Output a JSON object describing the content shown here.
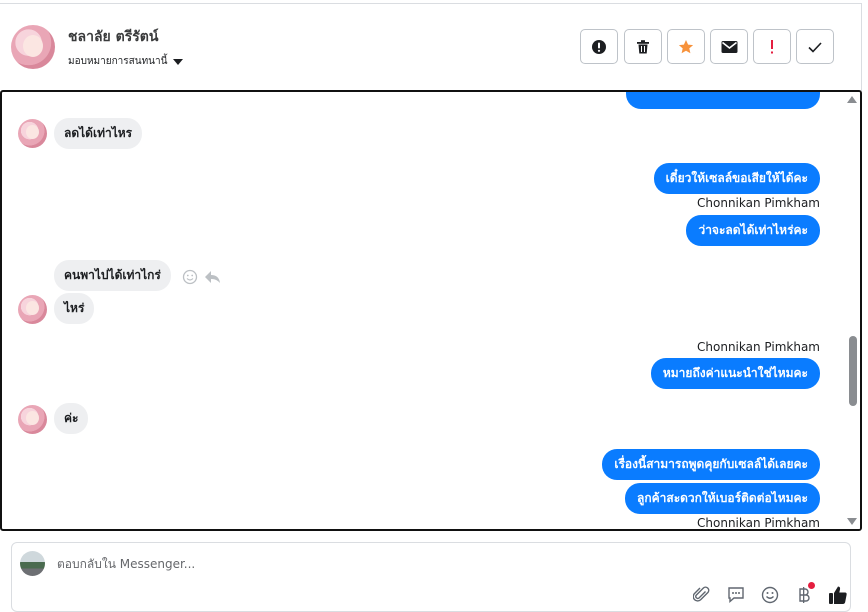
{
  "header": {
    "contact_name": "ชลาลัย ตรีรัตน์",
    "assign_label": "มอบหมายการสนทนานี้",
    "toolbar": [
      {
        "name": "spam-button",
        "icon": "alert-circle-icon"
      },
      {
        "name": "delete-button",
        "icon": "trash-icon"
      },
      {
        "name": "star-button",
        "icon": "star-icon",
        "color": "#f7923b"
      },
      {
        "name": "mark-unread-button",
        "icon": "envelope-icon"
      },
      {
        "name": "follow-up-button",
        "icon": "exclamation-icon",
        "color": "#e41e3f"
      },
      {
        "name": "mark-done-button",
        "icon": "checkmark-icon"
      }
    ]
  },
  "conversation": {
    "accent_color": "#0a7cff",
    "messages": [
      {
        "side": "in",
        "text": "ลดได้เท่าไหร"
      },
      {
        "side": "out",
        "text": "เดี๋ยวให้เซลล์ขอเสียให้ได้คะ"
      },
      {
        "side": "sender",
        "text": "Chonnikan Pimkham"
      },
      {
        "side": "out",
        "text": "ว่าจะลดได้เท่าไหร่คะ"
      },
      {
        "side": "in",
        "text": "คนพาไปได้เท่าไกร่"
      },
      {
        "side": "in",
        "text": "ไหร่"
      },
      {
        "side": "sender",
        "text": "Chonnikan Pimkham"
      },
      {
        "side": "out",
        "text": "หมายถึงค่าแนะนำใช่ไหมคะ"
      },
      {
        "side": "in",
        "text": "ค่ะ"
      },
      {
        "side": "out",
        "text": "เรื่องนี้สามารถพูดคุยกับเซลล์ได้เลยคะ"
      },
      {
        "side": "out",
        "text": "ลูกค้าสะดวกให้เบอร์ติดต่อไหมคะ"
      },
      {
        "side": "sender",
        "text": "Chonnikan Pimkham"
      }
    ]
  },
  "composer": {
    "placeholder": "ตอบกลับใน Messenger...",
    "icons": [
      "paperclip-icon",
      "saved-replies-icon",
      "emoji-icon",
      "baht-payment-icon",
      "thumbs-up-icon"
    ]
  }
}
